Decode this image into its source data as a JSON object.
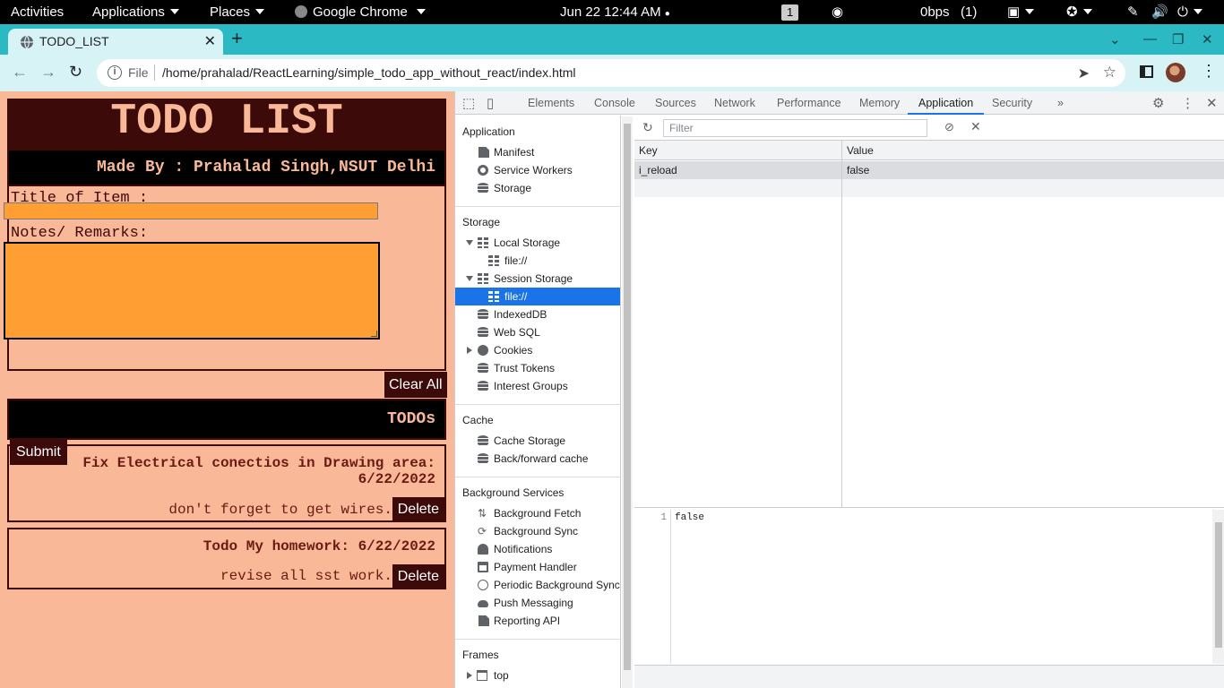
{
  "system_bar": {
    "activities": "Activities",
    "applications": "Applications",
    "places": "Places",
    "app": "Google Chrome",
    "datetime": "Jun 22  12:44 AM",
    "workspace": "1",
    "net_speed": "0bps",
    "net_count": "(1)"
  },
  "browser": {
    "tab_title": "TODO_LIST",
    "url_scheme": "File",
    "url": "/home/prahalad/ReactLearning/simple_todo_app_without_react/index.html"
  },
  "page": {
    "title": "TODO LIST",
    "made_by": "Made By : Prahalad Singh,NSUT Delhi",
    "title_label": "Title of Item :",
    "notes_label": "Notes/ Remarks:",
    "title_value": "",
    "notes_value": "",
    "submit_label": "Submit",
    "clear_all_label": "Clear All",
    "todos_heading": "TODOs",
    "todos": [
      {
        "title_line1": "Fix Electrical conectios in Drawing area:",
        "title_line2": "6/22/2022",
        "notes": "don't forget to get wires.",
        "delete_label": "Delete"
      },
      {
        "title_line1": "Todo My homework: 6/22/2022",
        "notes": "revise all sst work.",
        "delete_label": "Delete"
      }
    ],
    "colors": {
      "background": "#f9b897",
      "dark": "#3c0a09",
      "input": "#ff9e32"
    }
  },
  "devtools": {
    "tabs": [
      "Elements",
      "Console",
      "Sources",
      "Network",
      "Performance",
      "Memory",
      "Application",
      "Security",
      "»"
    ],
    "active_tab": "Application",
    "sidebar": {
      "application": {
        "heading": "Application",
        "items": [
          "Manifest",
          "Service Workers",
          "Storage"
        ]
      },
      "storage": {
        "heading": "Storage",
        "local_storage": "Local Storage",
        "local_file": "file://",
        "session_storage": "Session Storage",
        "session_file": "file://",
        "items": [
          "IndexedDB",
          "Web SQL",
          "Cookies",
          "Trust Tokens",
          "Interest Groups"
        ]
      },
      "cache": {
        "heading": "Cache",
        "items": [
          "Cache Storage",
          "Back/forward cache"
        ]
      },
      "background": {
        "heading": "Background Services",
        "items": [
          "Background Fetch",
          "Background Sync",
          "Notifications",
          "Payment Handler",
          "Periodic Background Sync",
          "Push Messaging",
          "Reporting API"
        ]
      },
      "frames": {
        "heading": "Frames",
        "items": [
          "top"
        ]
      }
    },
    "filter_placeholder": "Filter",
    "table": {
      "headers": [
        "Key",
        "Value"
      ],
      "rows": [
        {
          "key": "i_reload",
          "value": "false"
        }
      ]
    },
    "preview": {
      "line_number": "1",
      "content": "false"
    }
  }
}
